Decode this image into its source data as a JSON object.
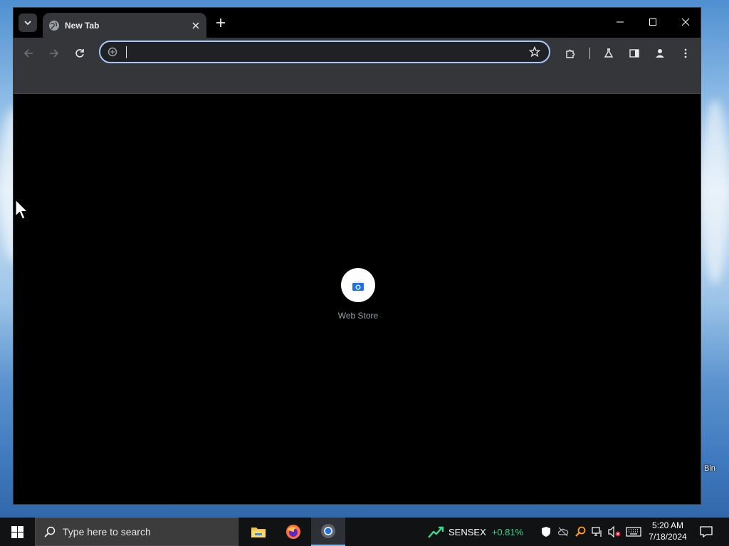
{
  "browser": {
    "tab": {
      "title": "New Tab"
    },
    "omnibox": {
      "value": "",
      "placeholder": ""
    },
    "shortcuts": [
      {
        "label": "Web Store"
      }
    ]
  },
  "taskbar": {
    "search_placeholder": "Type here to search",
    "ticker": {
      "name": "SENSEX",
      "change": "+0.81%"
    },
    "clock": {
      "time": "5:20 AM",
      "date": "7/18/2024"
    }
  },
  "desktop": {
    "icon_labels": [
      "Bin"
    ]
  },
  "colors": {
    "omnibox_focus_ring": "#a8c7fa",
    "toolbar_bg": "#35363a",
    "page_bg": "#000000",
    "ticker_positive": "#3dd68c"
  }
}
